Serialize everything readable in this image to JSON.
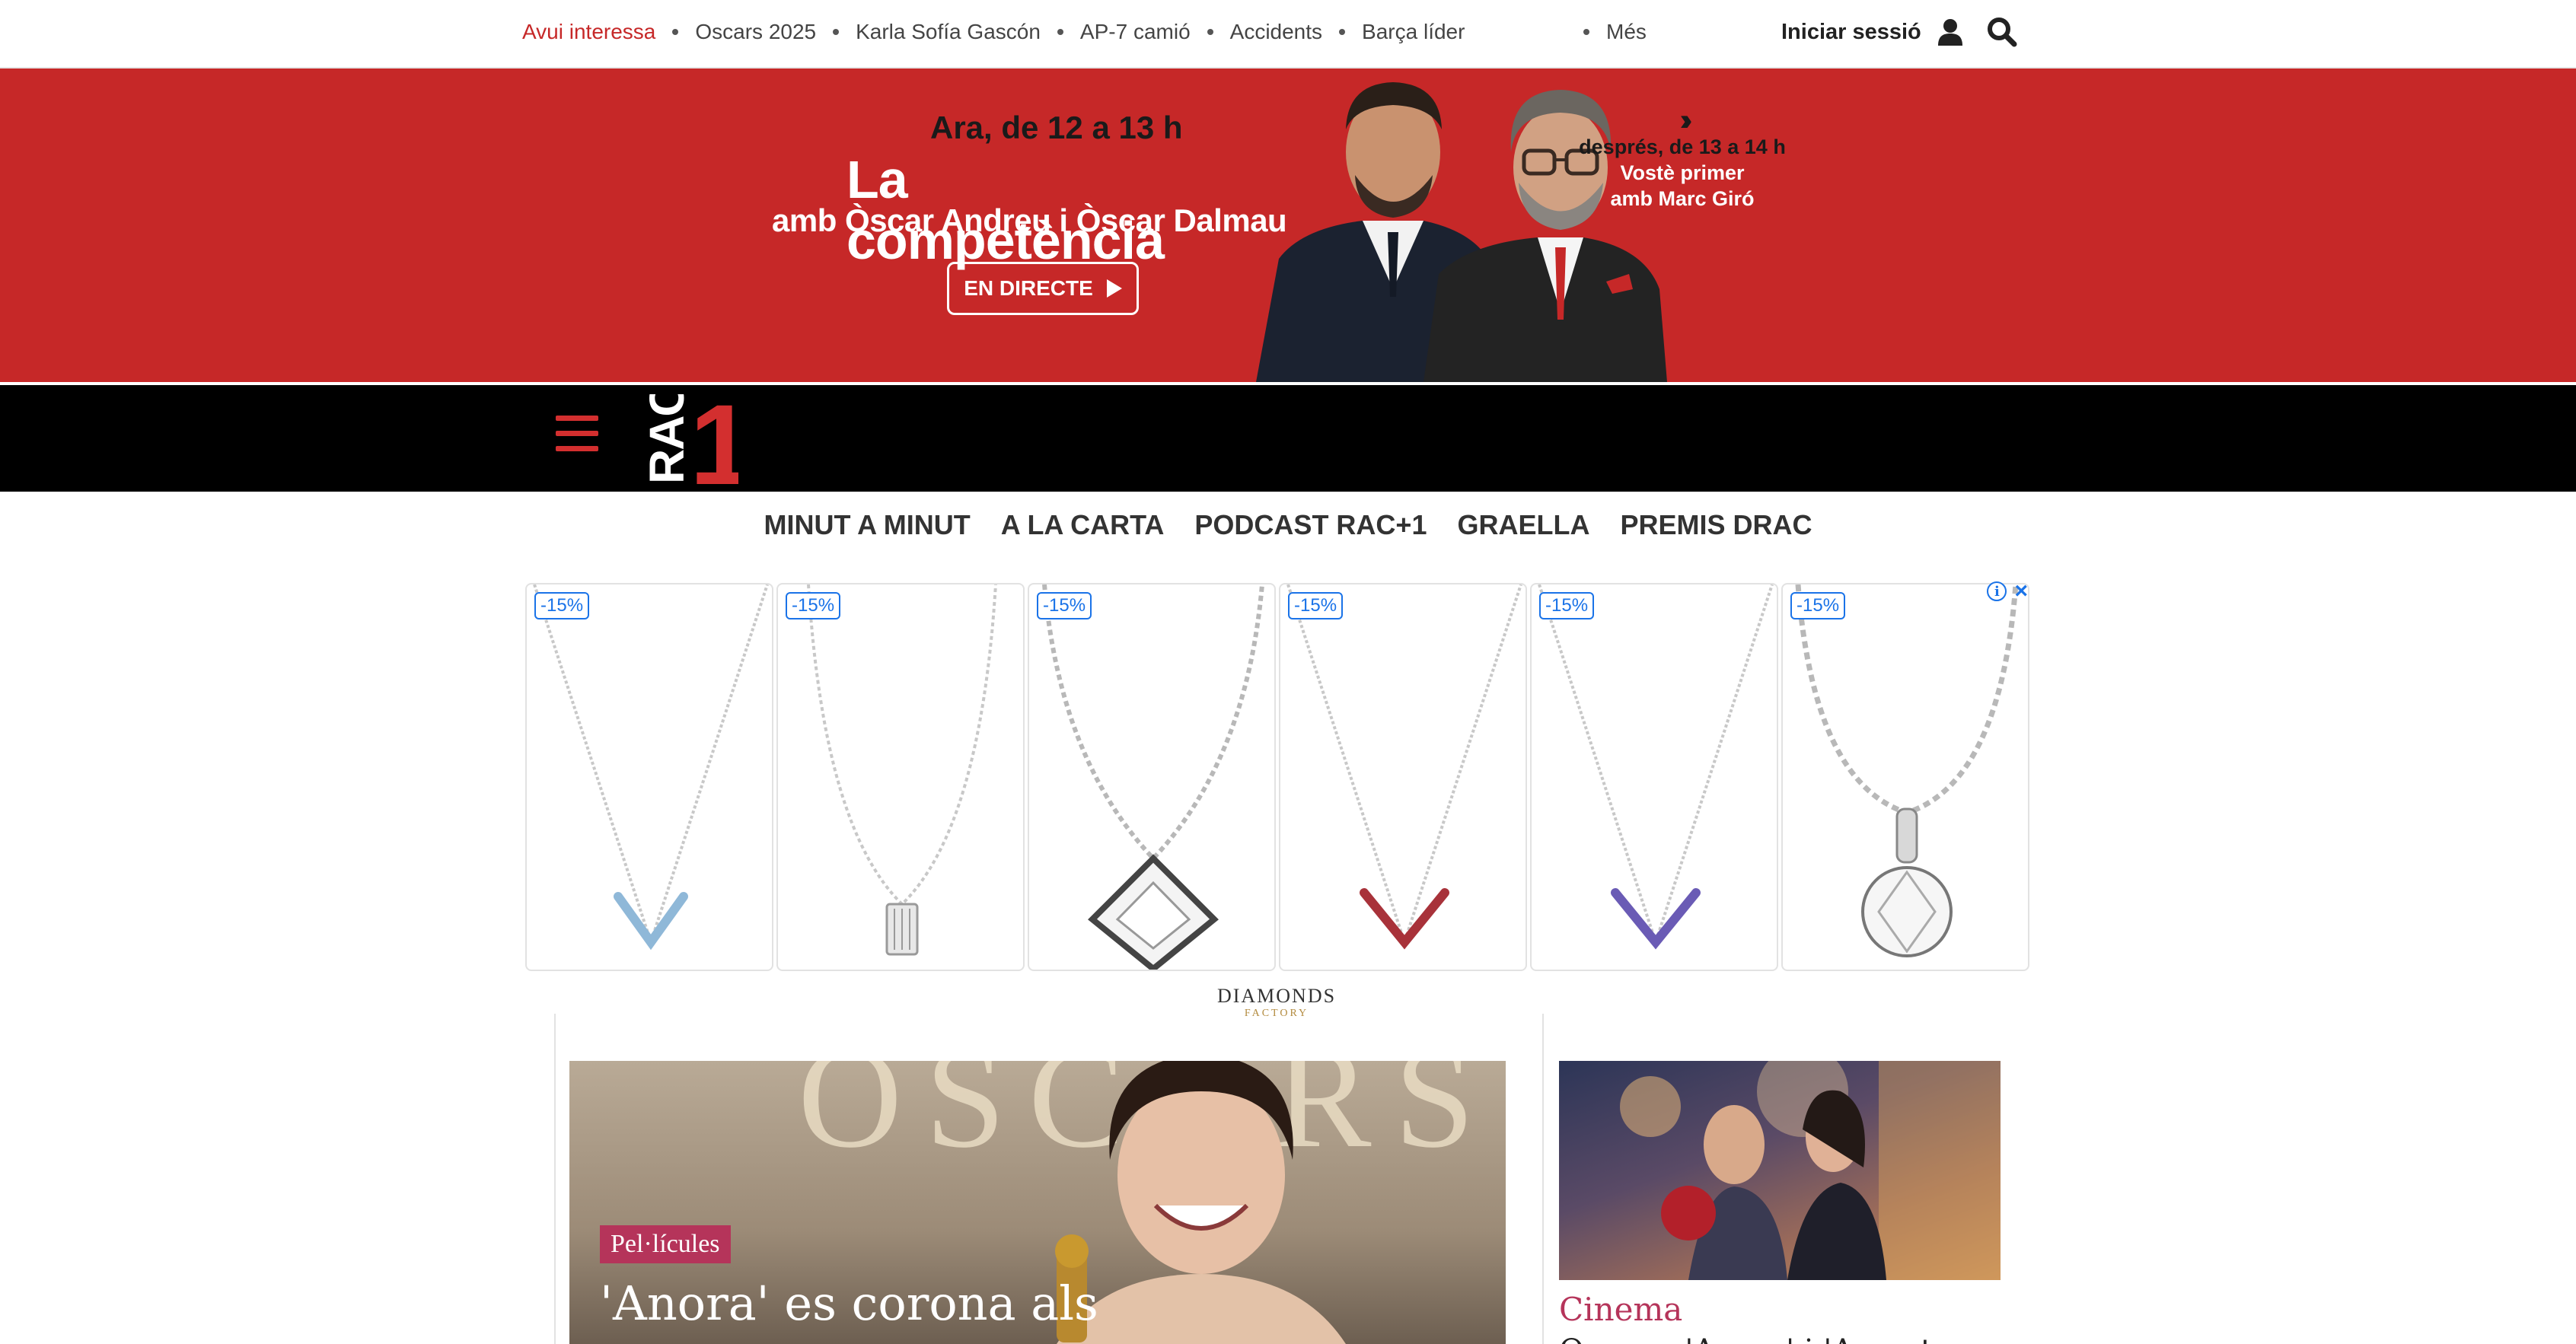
{
  "trending": {
    "label": "Avui interessa",
    "items": [
      "Oscars 2025",
      "Karla Sofía Gascón",
      "AP-7 camió",
      "Accidents",
      "Barça líder"
    ],
    "more": "Més"
  },
  "account": {
    "login_label": "Iniciar sessió",
    "user_icon": "user-icon",
    "search_icon": "search-icon"
  },
  "promo": {
    "now_slot": "Ara, de 12 a 13 h",
    "show_title": "La competència",
    "hosts": "amb Òscar Andreu i Òscar Dalmau",
    "live_button": "EN DIRECTE",
    "next_slot": "després, de 13 a 14 h",
    "next_show": "Vostè primer",
    "next_host": "amb Marc Giró",
    "colors": {
      "background": "#c62828",
      "text_dark": "#1a1a1a"
    }
  },
  "brand": {
    "logo_text_vertical": "RAC",
    "logo_digit": "1",
    "menu_icon": "hamburger-icon",
    "accent": "#d32f2f"
  },
  "section_nav": [
    "MINUT A MINUT",
    "A LA CARTA",
    "PODCAST RAC+1",
    "GRAELLA",
    "PREMIS DRAC"
  ],
  "ad": {
    "items": [
      {
        "discount": "-15%",
        "kind": "v-bar-necklace",
        "stone_color": "#8fb8d8"
      },
      {
        "discount": "-15%",
        "kind": "baguette-pendant",
        "stone_color": "#e0e0e0"
      },
      {
        "discount": "-15%",
        "kind": "princess-pendant",
        "stone_color": "#f4f4f4"
      },
      {
        "discount": "-15%",
        "kind": "v-bar-necklace",
        "stone_color": "#a8323a"
      },
      {
        "discount": "-15%",
        "kind": "v-bar-necklace",
        "stone_color": "#6a5bb5"
      },
      {
        "discount": "-15%",
        "kind": "solitaire-pendant",
        "stone_color": "#f4f4f4"
      }
    ],
    "brand_name": "DIAMONDS",
    "brand_sub": "FACTORY",
    "info_icon": "info-icon",
    "close_icon": "close-icon"
  },
  "news": {
    "main": {
      "tag": "Pel·lícules",
      "headline": "'Anora' es corona als",
      "photo_text": "OSCARS"
    },
    "side": {
      "tag": "Cinema",
      "headline": "Oscars: 'Anora' i 'Amant"
    }
  }
}
